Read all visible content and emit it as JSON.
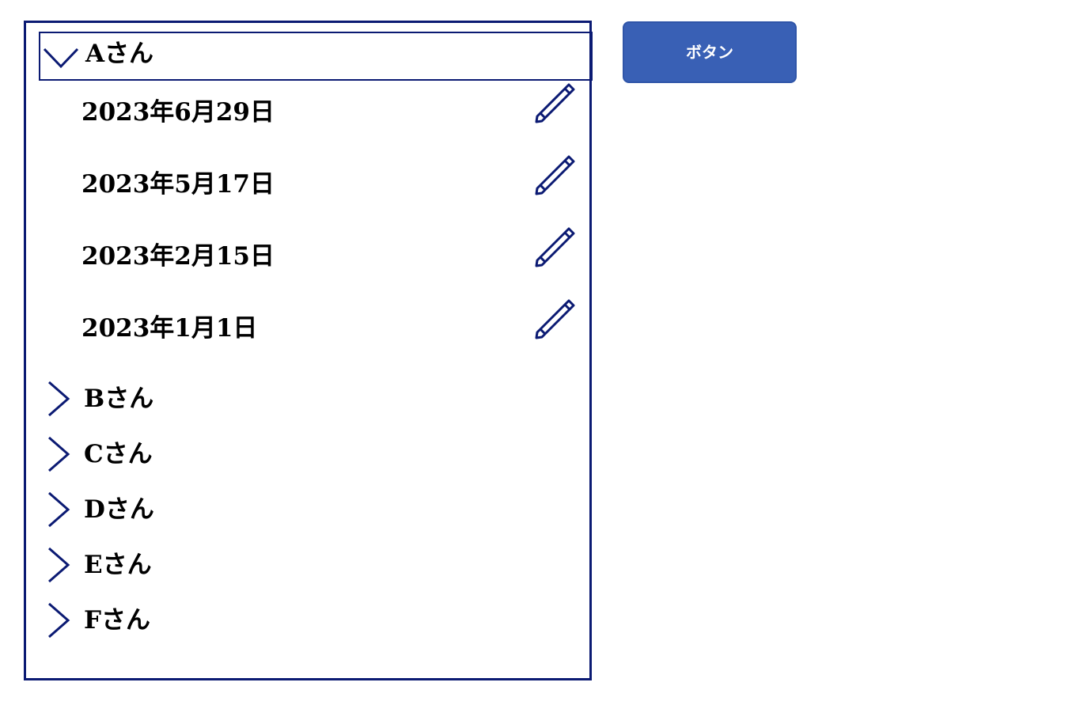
{
  "people_list": {
    "expanded_person": {
      "label": "Aさん",
      "dates": [
        {
          "label": "2023年6月29日",
          "icon": "pencil-icon"
        },
        {
          "label": "2023年5月17日",
          "icon": "pencil-icon"
        },
        {
          "label": "2023年2月15日",
          "icon": "pencil-icon"
        },
        {
          "label": "2023年1月1日",
          "icon": "pencil-icon"
        }
      ]
    },
    "collapsed_people": [
      {
        "label": "Bさん",
        "icon": "chevron-right-icon"
      },
      {
        "label": "Cさん",
        "icon": "chevron-right-icon"
      },
      {
        "label": "Dさん",
        "icon": "chevron-right-icon"
      },
      {
        "label": "Eさん",
        "icon": "chevron-right-icon"
      },
      {
        "label": "Fさん",
        "icon": "chevron-right-icon"
      }
    ],
    "expanded_icon": "chevron-down-icon"
  },
  "button": {
    "label": "ボタン"
  },
  "colors": {
    "border": "#0b1a73",
    "button_background": "#3960b5",
    "button_text": "#ffffff"
  }
}
